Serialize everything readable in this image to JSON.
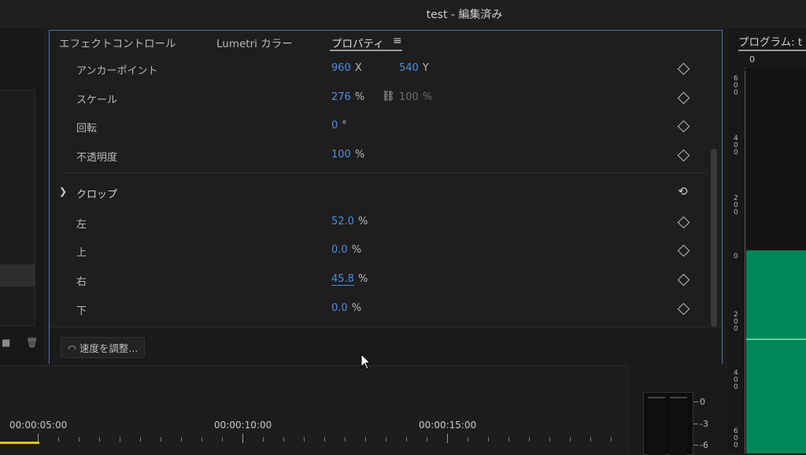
{
  "window": {
    "title": "test - 編集済み"
  },
  "effect_controls": {
    "tabs": [
      {
        "label": "エフェクトコントロール"
      },
      {
        "label": "Lumetri カラー"
      },
      {
        "label": "プロパティ"
      }
    ],
    "menu_icon": "hamburger-menu-icon",
    "properties": {
      "anchor": {
        "label": "アンカーポイント",
        "x": "960",
        "x_unit": "X",
        "y": "540",
        "y_unit": "Y"
      },
      "scale": {
        "label": "スケール",
        "value": "276",
        "unit": "%",
        "value2": "100",
        "unit2": "%"
      },
      "rotation": {
        "label": "回転",
        "value": "0",
        "unit": "°"
      },
      "opacity": {
        "label": "不透明度",
        "value": "100",
        "unit": "%"
      }
    },
    "crop": {
      "title": "クロップ",
      "left": {
        "label": "左",
        "value": "52.0",
        "unit": "%"
      },
      "top": {
        "label": "上",
        "value": "0.0",
        "unit": "%"
      },
      "right": {
        "label": "右",
        "value": "45.8",
        "unit": "%"
      },
      "bottom": {
        "label": "下",
        "value": "0.0",
        "unit": "%"
      }
    },
    "speed_button": "速度を調整..."
  },
  "program_monitor": {
    "title": "プログラム: t",
    "ruler_top_zero": "0",
    "ruler_left": [
      "600",
      "400",
      "200",
      "0",
      "200",
      "400",
      "600"
    ],
    "colors": {
      "video_fill": "#00875a"
    }
  },
  "timeline": {
    "timecodes": [
      "00:00:05:00",
      "00:00:10:00",
      "00:00:15:00"
    ]
  },
  "audio_meter": {
    "labels": [
      "0",
      "-3",
      "-6"
    ]
  }
}
